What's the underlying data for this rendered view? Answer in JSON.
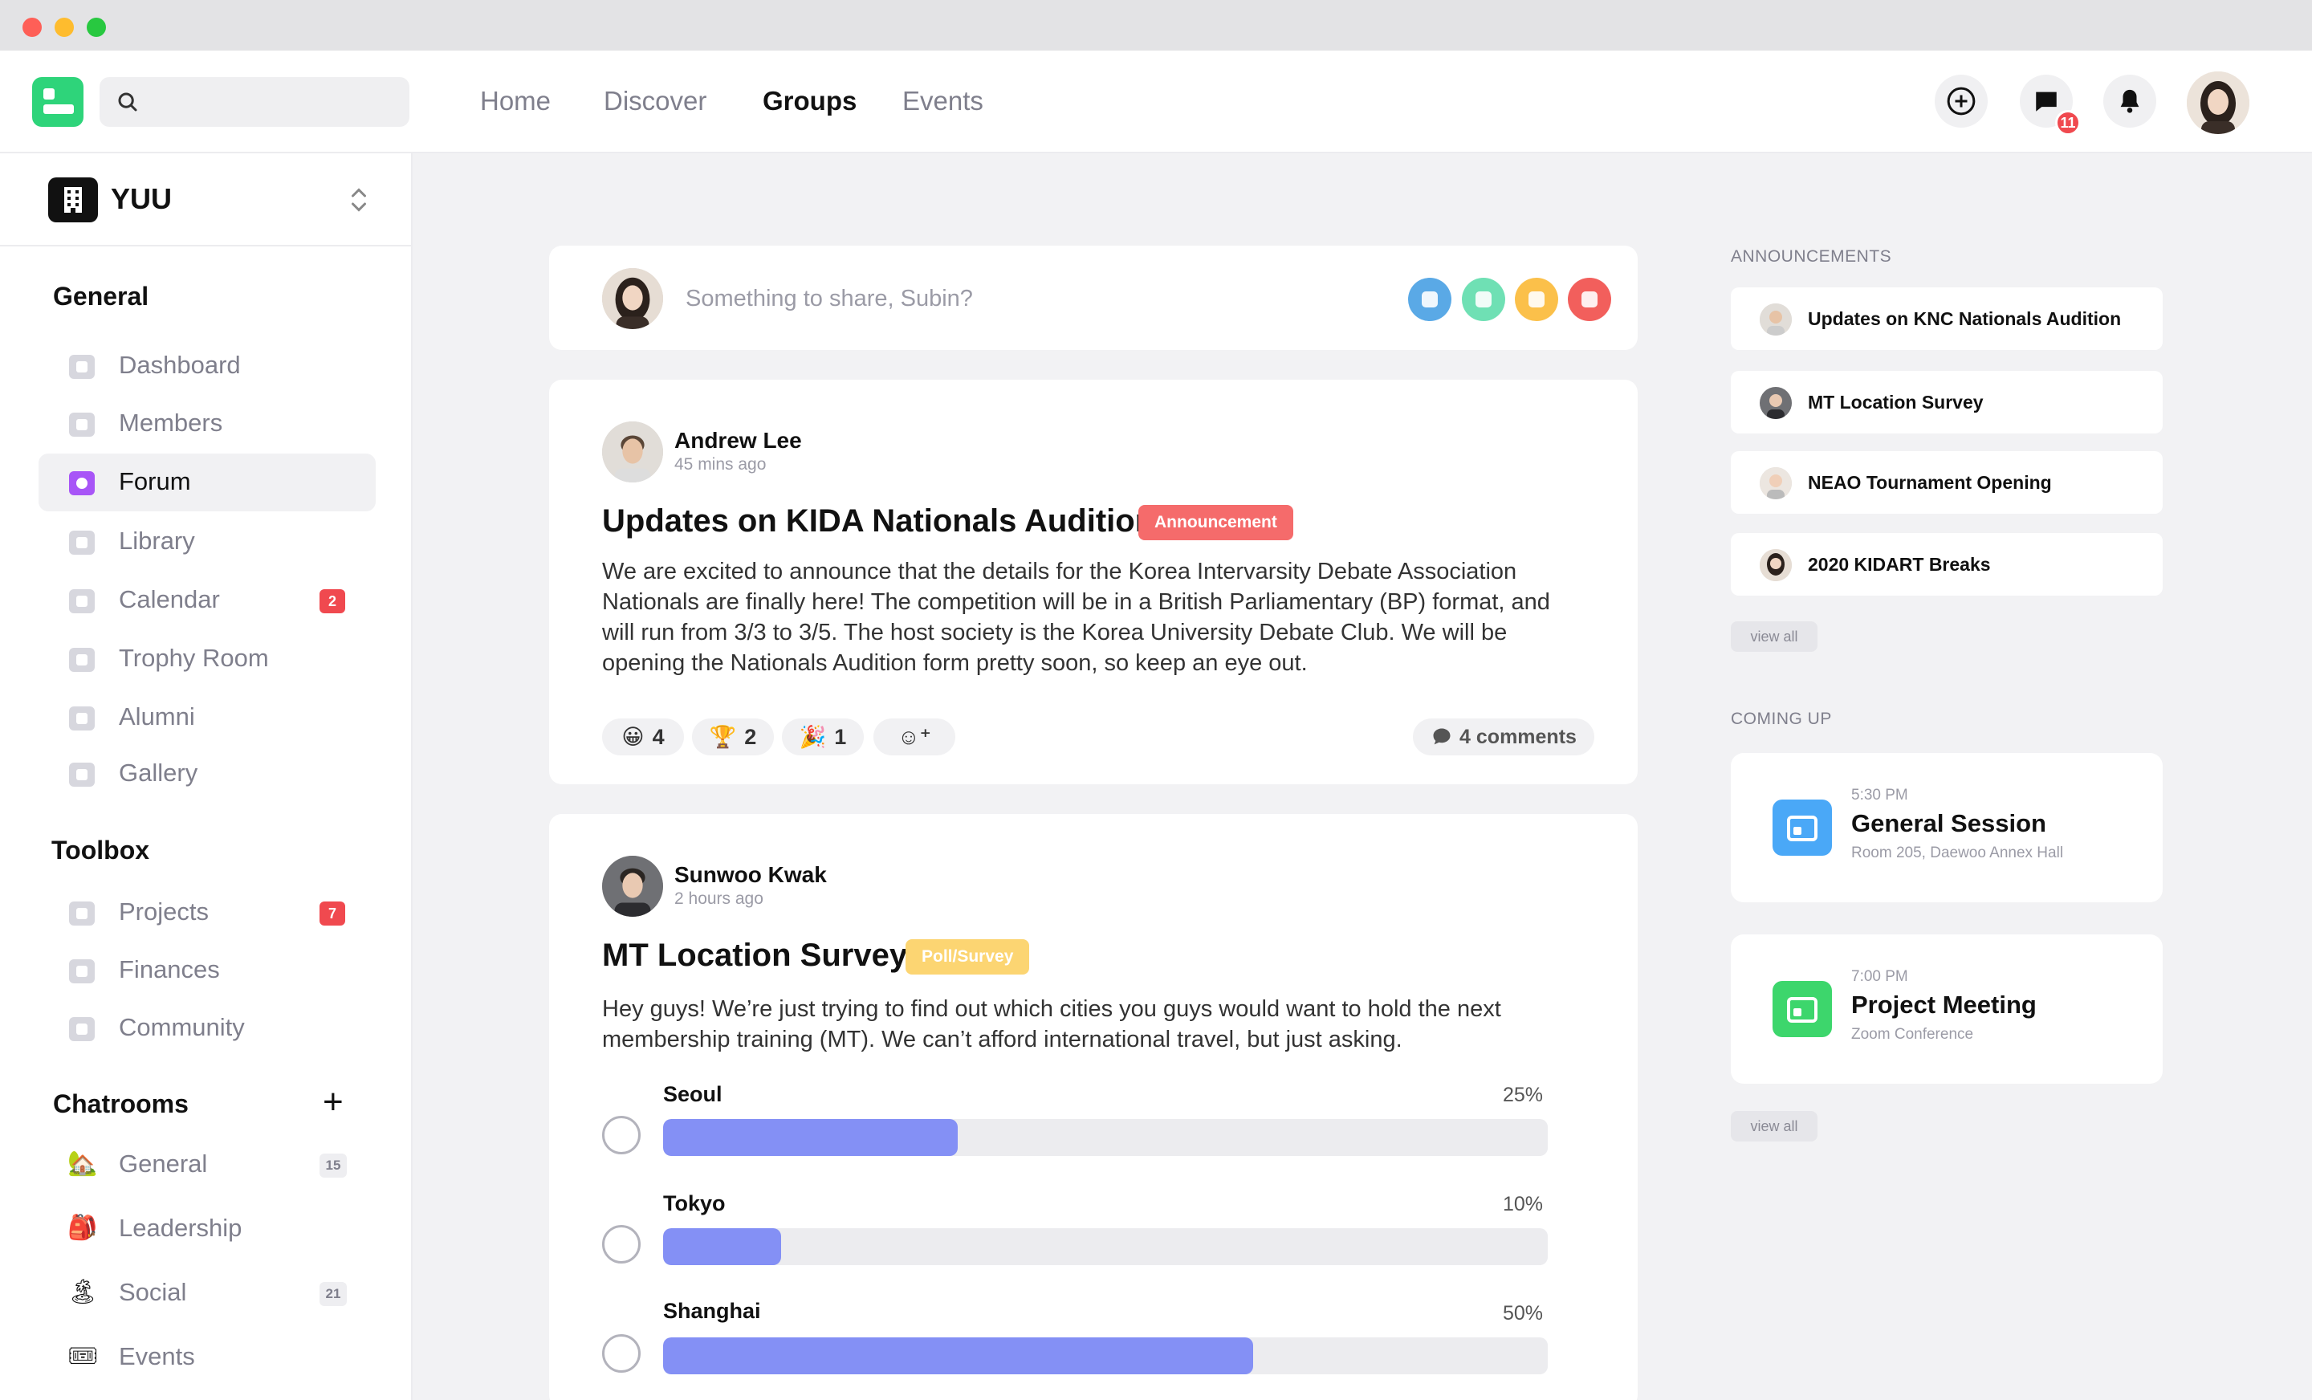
{
  "window": {
    "title": ""
  },
  "nav": {
    "search_placeholder": "",
    "links": [
      "Home",
      "Discover",
      "Groups",
      "Events"
    ],
    "active": "Groups",
    "messages_badge": "11"
  },
  "sidebar": {
    "org_name": "YUU",
    "sections": {
      "general": "General",
      "toolbox": "Toolbox",
      "chatrooms": "Chatrooms"
    },
    "general_items": [
      {
        "label": "Dashboard",
        "icon": "home-icon"
      },
      {
        "label": "Members",
        "icon": "members-icon"
      },
      {
        "label": "Forum",
        "icon": "forum-icon"
      },
      {
        "label": "Library",
        "icon": "library-icon"
      },
      {
        "label": "Calendar",
        "icon": "calendar-icon",
        "count": "2"
      },
      {
        "label": "Trophy Room",
        "icon": "trophy-icon"
      },
      {
        "label": "Alumni",
        "icon": "alumni-icon"
      },
      {
        "label": "Gallery",
        "icon": "gallery-icon"
      }
    ],
    "toolbox_items": [
      {
        "label": "Projects",
        "icon": "projects-icon",
        "count": "7"
      },
      {
        "label": "Finances",
        "icon": "finances-icon"
      },
      {
        "label": "Community",
        "icon": "community-icon"
      }
    ],
    "chatroom_items": [
      {
        "label": "General",
        "emoji": "🏡",
        "count": "15"
      },
      {
        "label": "Leadership",
        "emoji": "🎒"
      },
      {
        "label": "Social",
        "emoji": "🏝",
        "count": "21"
      },
      {
        "label": "Events",
        "emoji": "🎟"
      }
    ],
    "add_chatroom": "+"
  },
  "composer": {
    "placeholder": "Something to share, Subin?"
  },
  "post1": {
    "author": "Andrew Lee",
    "time": "45 mins ago",
    "title": "Updates on KIDA Nationals Audition",
    "tag": "Announcement",
    "body": "We are excited to announce that the details for the Korea Intervarsity Debate Association Nationals are finally here! The competition will be in a British Parliamentary (BP) format, and will run from 3/3 to 3/5. The host society is the Korea University Debate Club. We will be opening the Nationals Audition form pretty soon, so keep an eye out.",
    "reactions": [
      {
        "emoji": "😀",
        "count": "4"
      },
      {
        "emoji": "🏆",
        "count": "2"
      },
      {
        "emoji": "🎉",
        "count": "1"
      }
    ],
    "add_reaction": "☺⁺",
    "comments": "4 comments"
  },
  "post2": {
    "author": "Sunwoo Kwak",
    "time": "2 hours ago",
    "title": "MT Location Survey",
    "tag": "Poll/Survey",
    "body": "Hey guys! We’re just trying to find out which cities you guys would want to hold the next membership training (MT). We can’t afford international travel, but just asking.",
    "options": [
      {
        "label": "Seoul",
        "pct": "25%",
        "value": 25
      },
      {
        "label": "Tokyo",
        "pct": "10%",
        "value": 10
      },
      {
        "label": "Shanghai",
        "pct": "50%",
        "value": 50
      }
    ]
  },
  "announcements": {
    "title": "ANNOUNCEMENTS",
    "items": [
      "Updates on KNC Nationals Audition",
      "MT Location Survey",
      "NEAO Tournament Opening",
      "2020 KIDART Breaks"
    ],
    "view_all": "view all"
  },
  "coming_up": {
    "title": "COMING UP",
    "events": [
      {
        "time": "5:30 PM",
        "title": "General Session",
        "location": "Room 205, Daewoo Annex Hall",
        "color": "#4aa8f7"
      },
      {
        "time": "7:00 PM",
        "title": "Project Meeting",
        "location": "Zoom Conference",
        "color": "#3dd66c"
      }
    ],
    "view_all": "view all"
  },
  "colors": {
    "accent_green": "#2ed47a",
    "poll_fill": "#8490f5",
    "badge_red": "#f0494f"
  }
}
